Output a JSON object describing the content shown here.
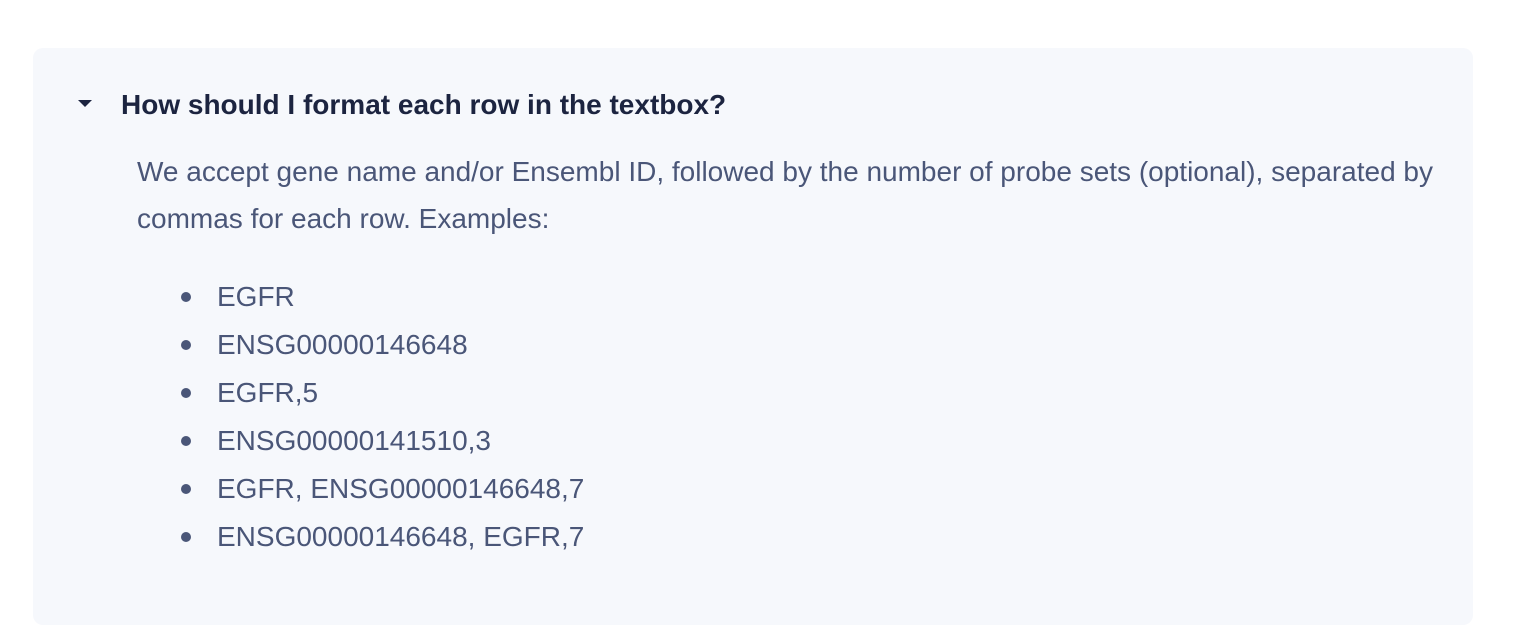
{
  "faq": {
    "question": "How should I format each row in the textbox?",
    "answer": "We accept gene name and/or Ensembl ID, followed by the number of probe sets (optional), separated by commas for each row. Examples:",
    "examples": [
      "EGFR",
      "ENSG00000146648",
      "EGFR,5",
      "ENSG00000141510,3",
      "EGFR, ENSG00000146648,7",
      "ENSG00000146648, EGFR,7"
    ],
    "expanded": true
  },
  "icons": {
    "toggle": "caret-down-icon",
    "list_marker": "bullet-icon"
  },
  "colors": {
    "panel_background": "#f6f8fc",
    "heading_text": "#1c2440",
    "body_text": "#4a5678"
  }
}
